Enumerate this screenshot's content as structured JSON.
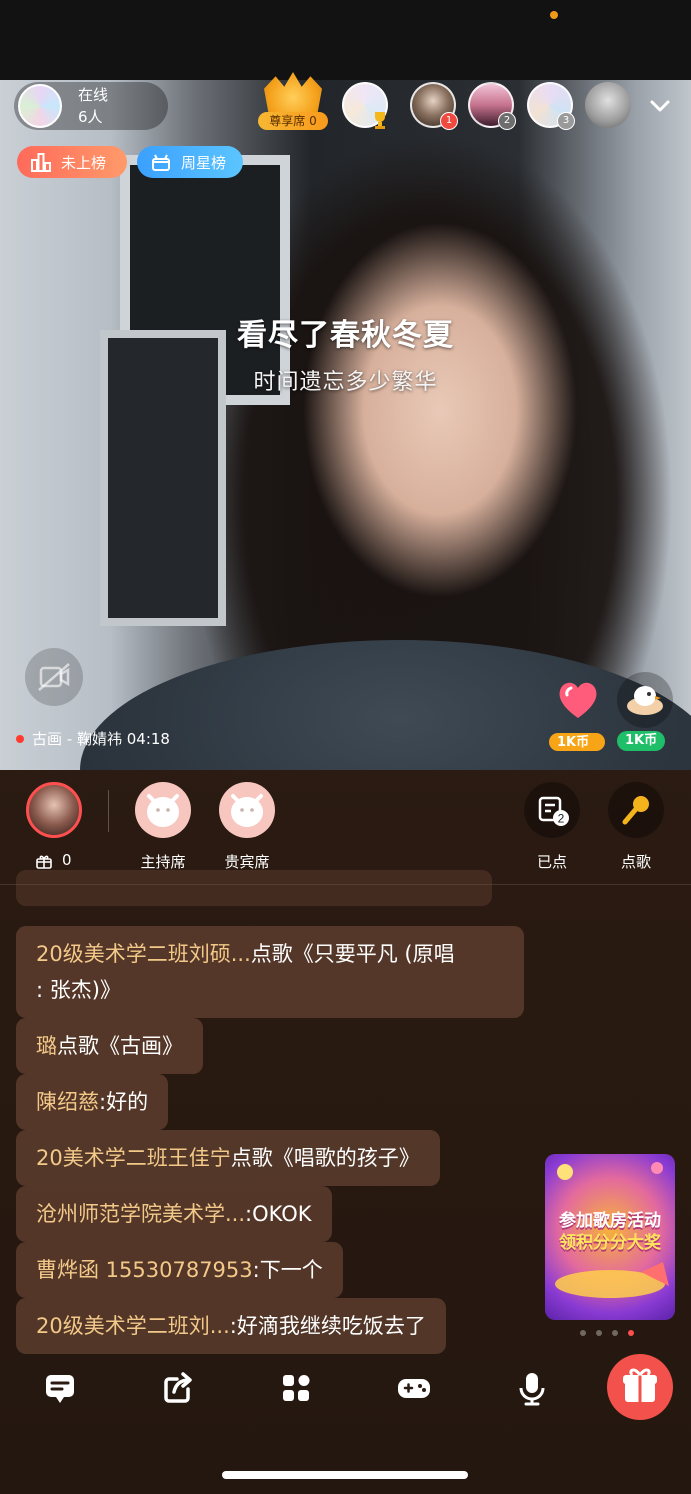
{
  "status": {},
  "header": {
    "online_label": "在线",
    "online_count": "6人",
    "vip_seat_label": "尊享席 0",
    "audience_ranks": [
      "1",
      "2",
      "3"
    ]
  },
  "ranks": {
    "not_ranked": "未上榜",
    "weekly_star": "周星榜"
  },
  "lyrics": {
    "line1": "看尽了春秋冬夏",
    "line2": "时间遗忘多少繁华"
  },
  "now_playing": {
    "song": "古画 - 鞠婧祎",
    "time": "04:18"
  },
  "gifts": {
    "heart_price": "1K币",
    "bird_price": "1K币"
  },
  "seats": {
    "gift_count": "0",
    "host_label": "主持席",
    "guest_label": "贵宾席",
    "ordered_label": "已点",
    "ordered_count": "2",
    "request_label": "点歌"
  },
  "chat": [
    {
      "user": "20级美术学二班刘硕...",
      "text": "点歌《只要平凡 (原唱",
      "text2": ": 张杰)》"
    },
    {
      "user": "璐",
      "text": "点歌《古画》"
    },
    {
      "user": "陳绍慈",
      "text": ":好的"
    },
    {
      "user": "20美术学二班王佳宁",
      "text": "点歌《唱歌的孩子》"
    },
    {
      "user": "沧州师范学院美术学...",
      "text": ":OKOK"
    },
    {
      "user": "曹烨函 15530787953",
      "text": ":下一个"
    },
    {
      "user": "20级美术学二班刘...",
      "text": ":好滴我继续吃饭去了"
    }
  ],
  "promo": {
    "line1": "参加歌房活动",
    "line2": "领积分分大奖"
  },
  "colors": {
    "accent_orange": "#f5a21c",
    "gift_red": "#f2524b",
    "chat_name_gold": "#f3c98a"
  }
}
